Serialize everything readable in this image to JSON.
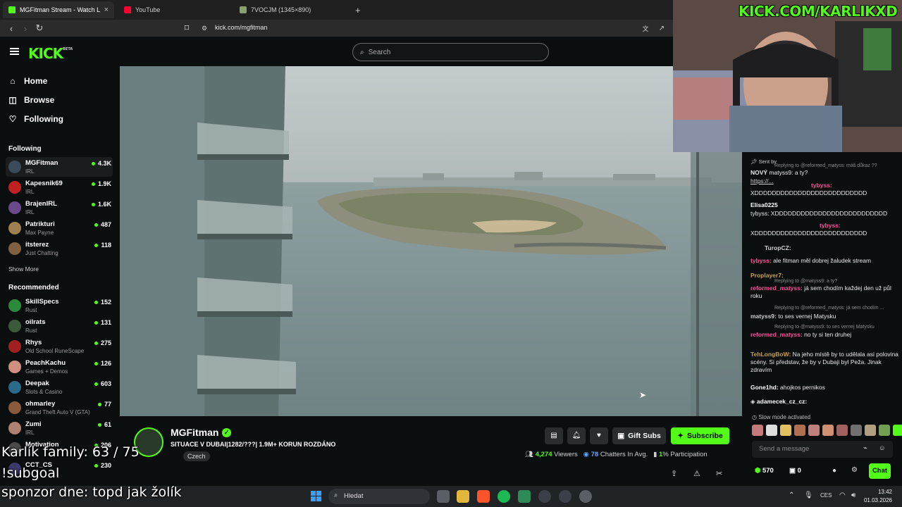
{
  "browser": {
    "tabs": [
      {
        "label": "MGFitman Stream - Watch Live o",
        "favicon_color": "#53fc18",
        "active": true
      },
      {
        "label": "YouTube",
        "favicon_color": "#ff0033",
        "active": false
      },
      {
        "label": "7VOCJM (1345×890)",
        "favicon_color": "#8aa070",
        "active": false
      }
    ],
    "url": "kick.com/mgfitman"
  },
  "header": {
    "logo": "KICK",
    "logo_badge": "BETA",
    "search_placeholder": "Search",
    "accent": "#53fc18"
  },
  "sidebar": {
    "nav": [
      {
        "label": "Home",
        "icon": "home-icon"
      },
      {
        "label": "Browse",
        "icon": "compass-icon"
      },
      {
        "label": "Following",
        "icon": "heart-icon"
      }
    ],
    "following_title": "Following",
    "following": [
      {
        "name": "MGFitman",
        "category": "IRL",
        "viewers": "4.3K",
        "color": "#3a4a5a"
      },
      {
        "name": "Kapesnik69",
        "category": "IRL",
        "viewers": "1.9K",
        "color": "#c02020"
      },
      {
        "name": "BrajenIRL",
        "category": "IRL",
        "viewers": "1.6K",
        "color": "#6a4a8a"
      },
      {
        "name": "Patrikturi",
        "category": "Max Payne",
        "viewers": "487",
        "color": "#a08050"
      },
      {
        "name": "itsterez",
        "category": "Just Chatting",
        "viewers": "118",
        "color": "#806040"
      }
    ],
    "show_more": "Show More",
    "recommended_title": "Recommended",
    "recommended": [
      {
        "name": "SkillSpecs",
        "category": "Rust",
        "viewers": "152",
        "color": "#2a8a3a"
      },
      {
        "name": "oilrats",
        "category": "Rust",
        "viewers": "131",
        "color": "#3a5a3a"
      },
      {
        "name": "Rhys",
        "category": "Old School RuneScape",
        "viewers": "275",
        "color": "#a02020"
      },
      {
        "name": "PeachKachu",
        "category": "Games + Demos",
        "viewers": "126",
        "color": "#d09080"
      },
      {
        "name": "Deepak",
        "category": "Slots & Casino",
        "viewers": "603",
        "color": "#2a6a8a"
      },
      {
        "name": "ohmarley",
        "category": "Grand Theft Auto V (GTA)",
        "viewers": "77",
        "color": "#8a5a3a"
      },
      {
        "name": "Zumi",
        "category": "IRL",
        "viewers": "61",
        "color": "#b08070"
      },
      {
        "name": "Motivation",
        "category": "",
        "viewers": "206",
        "color": "#4a4a4a"
      },
      {
        "name": "CCT_CS",
        "category": "",
        "viewers": "230",
        "color": "#3a3a6a"
      }
    ]
  },
  "stream": {
    "name": "MGFitman",
    "title": "SITUACE V DUBAI|1282/???| 1.9M+ KORUN ROZDÁNO",
    "tag": "Czech",
    "gift_label": "Gift Subs",
    "subscribe_label": "Subscribe",
    "viewers": "4,274",
    "viewers_label": "Viewers",
    "chatters": "78",
    "chatters_label": "Chatters In Avg.",
    "participation": "1",
    "participation_label": "% Participation"
  },
  "chat": {
    "messages": [
      {
        "user": "",
        "text": "Sent by",
        "type": "system"
      },
      {
        "user": "",
        "text": "Replying to @reformed_matyss: máš důkaz ??",
        "type": "reply"
      },
      {
        "user": "NOVÝ",
        "text": "matyss9: a ty?",
        "color": "#ffffff"
      },
      {
        "user": "",
        "text": "https://...",
        "type": "link"
      },
      {
        "user": "tybyss:",
        "text": "XDDDDDDDDDDDDDDDDDDDDDDDDDD",
        "color": "#ff4f9a"
      },
      {
        "user": "Elisa0225",
        "text": "tybyss: XDDDDDDDDDDDDDDDDDDDDDDDDDD",
        "color": "#ff4f9a"
      },
      {
        "user": "tybyss:",
        "text": "XDDDDDDDDDDDDDDDDDDDDDDDDDD",
        "color": "#ff4f9a"
      },
      {
        "user": "TuropCZ:",
        "text": "",
        "color": "#cfcfcf"
      },
      {
        "user": "tybyss:",
        "text": "ale fitman měl dobrej žaludek stream",
        "color": "#ff4f9a"
      },
      {
        "user": "Proplayer7:",
        "text": "",
        "color": "#c8a050"
      },
      {
        "user": "",
        "text": "Replying to @matyss9: a ty?",
        "type": "reply"
      },
      {
        "user": "reformed_matyss:",
        "text": "já sem chodím každej den už půl roku",
        "color": "#ff4f9a"
      },
      {
        "user": "",
        "text": "Replying to @reformed_matyss: já sem chodím ...",
        "type": "reply"
      },
      {
        "user": "matyss9:",
        "text": "to ses vernej Matysku",
        "color": "#cfcfcf"
      },
      {
        "user": "",
        "text": "Replying to @matyss9: to ses vernej Matysku",
        "type": "reply"
      },
      {
        "user": "reformed_matyss:",
        "text": "no ty si ten druhej",
        "color": "#ff4f9a"
      },
      {
        "user": "TehLongBoW:",
        "text": "Na jeho místě by to udělala asi polovina scény. Si představ, že by v Dubaji byl Peža. Jinak zdravím",
        "color": "#c8a050"
      },
      {
        "user": "Gone1hd:",
        "text": "ahojkos pernikos",
        "color": "#ffffff"
      },
      {
        "user": "adamecek_cz_cz:",
        "text": "",
        "color": "#ffffff"
      }
    ],
    "slow_mode": "Slow mode activated",
    "input_placeholder": "Send a message",
    "points": "570",
    "count": "0",
    "chat_button": "Chat"
  },
  "webcam": {
    "overlay_text": "KICK.COM/KARLIKXD"
  },
  "overlay": {
    "family": "Karlík family: 63 / 75",
    "subgoal": "!subgoal",
    "sponsor": "sponzor dne: topd jak žolík"
  },
  "taskbar": {
    "search_label": "Hledat",
    "language": "CES",
    "time": "13:42",
    "date": "01.03.2026"
  }
}
